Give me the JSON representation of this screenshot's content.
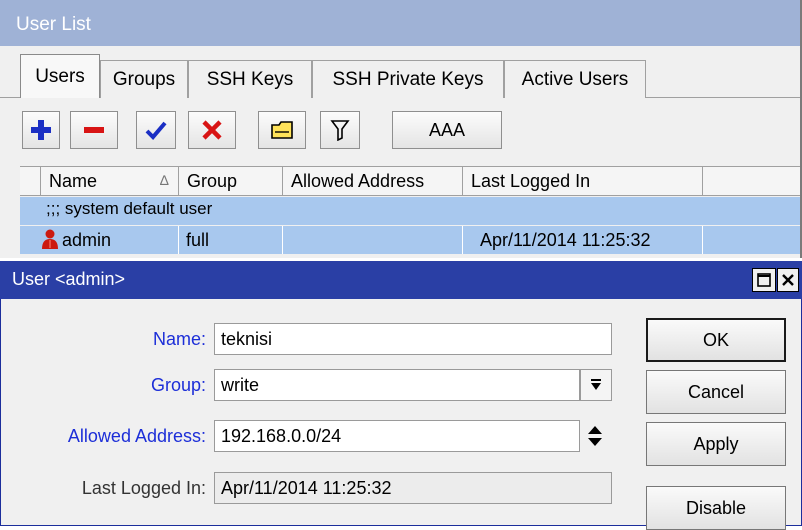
{
  "list_window": {
    "title": "User List",
    "tabs": [
      {
        "label": "Users",
        "active": true
      },
      {
        "label": "Groups",
        "active": false
      },
      {
        "label": "SSH Keys",
        "active": false
      },
      {
        "label": "SSH Private Keys",
        "active": false
      },
      {
        "label": "Active Users",
        "active": false
      }
    ],
    "toolbar": {
      "icons": [
        "add-icon",
        "remove-icon",
        "enable-check-icon",
        "disable-x-icon",
        "comment-icon",
        "filter-icon"
      ],
      "aaa_label": "AAA"
    },
    "table": {
      "columns": [
        "Name",
        "Group",
        "Allowed Address",
        "Last Logged In"
      ],
      "sort_indicator": "∆",
      "comment_row": ";;; system default user",
      "rows": [
        {
          "name": "admin",
          "group": "full",
          "allowed_address": "",
          "last_logged_in": "Apr/11/2014 11:25:32",
          "icon": "user-icon"
        }
      ]
    }
  },
  "dialog": {
    "title": "User <admin>",
    "fields": {
      "name_label": "Name:",
      "name_value": "teknisi",
      "group_label": "Group:",
      "group_value": "write",
      "allowed_label": "Allowed Address:",
      "allowed_value": "192.168.0.0/24",
      "last_label": "Last Logged In:",
      "last_value": "Apr/11/2014 11:25:32"
    },
    "buttons": {
      "ok": "OK",
      "cancel": "Cancel",
      "apply": "Apply",
      "disable": "Disable"
    },
    "colors": {
      "title_bar": "#2a3fa5",
      "list_title_bar": "#9fb2d6",
      "label_blue": "#1c2ed8",
      "selection": "#a8c8ee"
    }
  }
}
